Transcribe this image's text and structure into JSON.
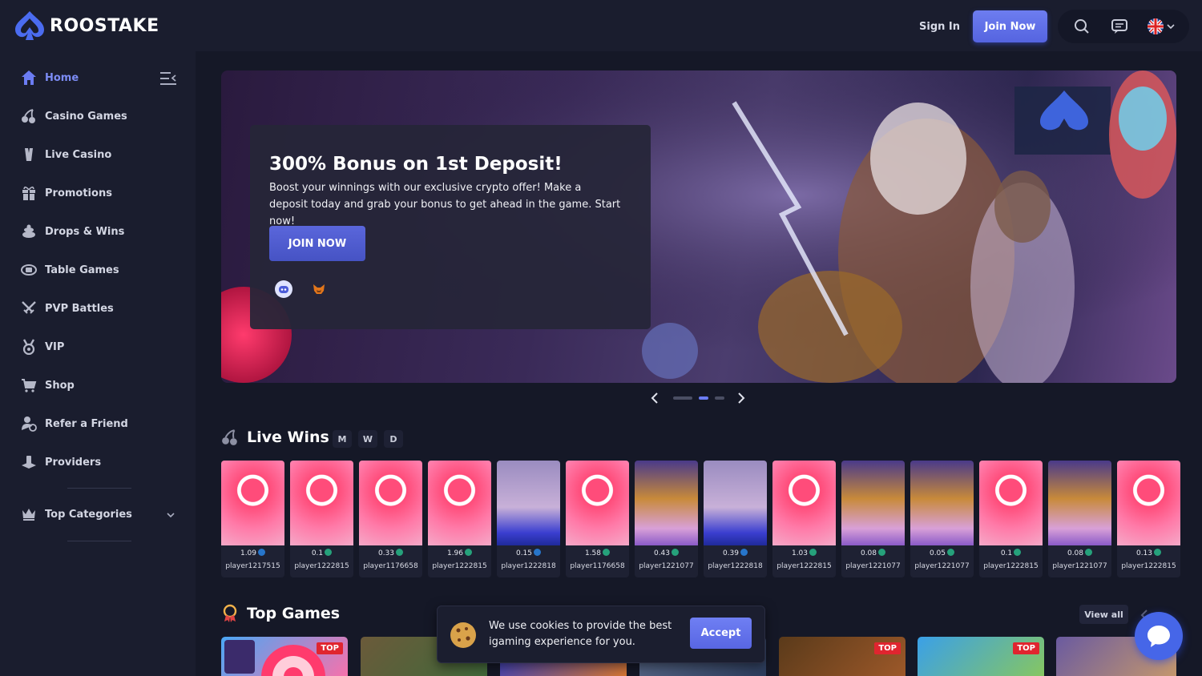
{
  "header": {
    "logo_text": "ROOSTAKE",
    "sign_in": "Sign In",
    "join_now": "Join Now"
  },
  "sidebar": {
    "items": [
      {
        "label": "Home",
        "icon": "home-icon",
        "active": true
      },
      {
        "label": "Casino Games",
        "icon": "cherries-icon"
      },
      {
        "label": "Live Casino",
        "icon": "live-casino-icon"
      },
      {
        "label": "Promotions",
        "icon": "gift-icon"
      },
      {
        "label": "Drops & Wins",
        "icon": "drops-wins-icon"
      },
      {
        "label": "Table Games",
        "icon": "table-games-icon"
      },
      {
        "label": "PVP Battles",
        "icon": "swords-icon"
      },
      {
        "label": "VIP",
        "icon": "medal-icon"
      },
      {
        "label": "Shop",
        "icon": "cart-icon"
      },
      {
        "label": "Refer a Friend",
        "icon": "refer-friend-icon"
      },
      {
        "label": "Providers",
        "icon": "providers-icon"
      }
    ],
    "top_categories": "Top Categories"
  },
  "banner": {
    "title": "300% Bonus on 1st Deposit!",
    "description": "Boost your winnings with our exclusive crypto offer! Make a deposit today and grab your bonus to get ahead in the game. Start now!",
    "cta": "JOIN NOW"
  },
  "live_wins": {
    "title": "Live Wins",
    "filters": [
      "M",
      "W",
      "D"
    ],
    "items": [
      {
        "amount": "1.09",
        "currency": "usdc",
        "user": "player1217515",
        "game": "pink"
      },
      {
        "amount": "0.1",
        "currency": "usdt",
        "user": "player1222815",
        "game": "pink"
      },
      {
        "amount": "0.33",
        "currency": "usdt",
        "user": "player1176658",
        "game": "pink"
      },
      {
        "amount": "1.96",
        "currency": "usdt",
        "user": "player1222815",
        "game": "pink"
      },
      {
        "amount": "0.15",
        "currency": "usdc",
        "user": "player1222818",
        "game": "blue"
      },
      {
        "amount": "1.58",
        "currency": "usdt",
        "user": "player1176658",
        "game": "pink"
      },
      {
        "amount": "0.43",
        "currency": "usdt",
        "user": "player1221077",
        "game": "gold"
      },
      {
        "amount": "0.39",
        "currency": "usdc",
        "user": "player1222818",
        "game": "blue"
      },
      {
        "amount": "1.03",
        "currency": "usdt",
        "user": "player1222815",
        "game": "pink"
      },
      {
        "amount": "0.08",
        "currency": "usdt",
        "user": "player1221077",
        "game": "gold"
      },
      {
        "amount": "0.05",
        "currency": "usdt",
        "user": "player1221077",
        "game": "gold"
      },
      {
        "amount": "0.1",
        "currency": "usdt",
        "user": "player1222815",
        "game": "pink"
      },
      {
        "amount": "0.08",
        "currency": "usdt",
        "user": "player1221077",
        "game": "gold"
      },
      {
        "amount": "0.13",
        "currency": "usdt",
        "user": "player1222815",
        "game": "pink"
      }
    ]
  },
  "top_games": {
    "title": "Top Games",
    "view_all": "View all",
    "tag": "TOP"
  },
  "cookie": {
    "text": "We use cookies to provide the best igaming experience for you.",
    "accept": "Accept"
  },
  "colors": {
    "accent": "#5b6be6",
    "background": "#151827",
    "panel": "#1a1d2e",
    "usdt": "#26a17b",
    "usdc": "#2775ca"
  }
}
